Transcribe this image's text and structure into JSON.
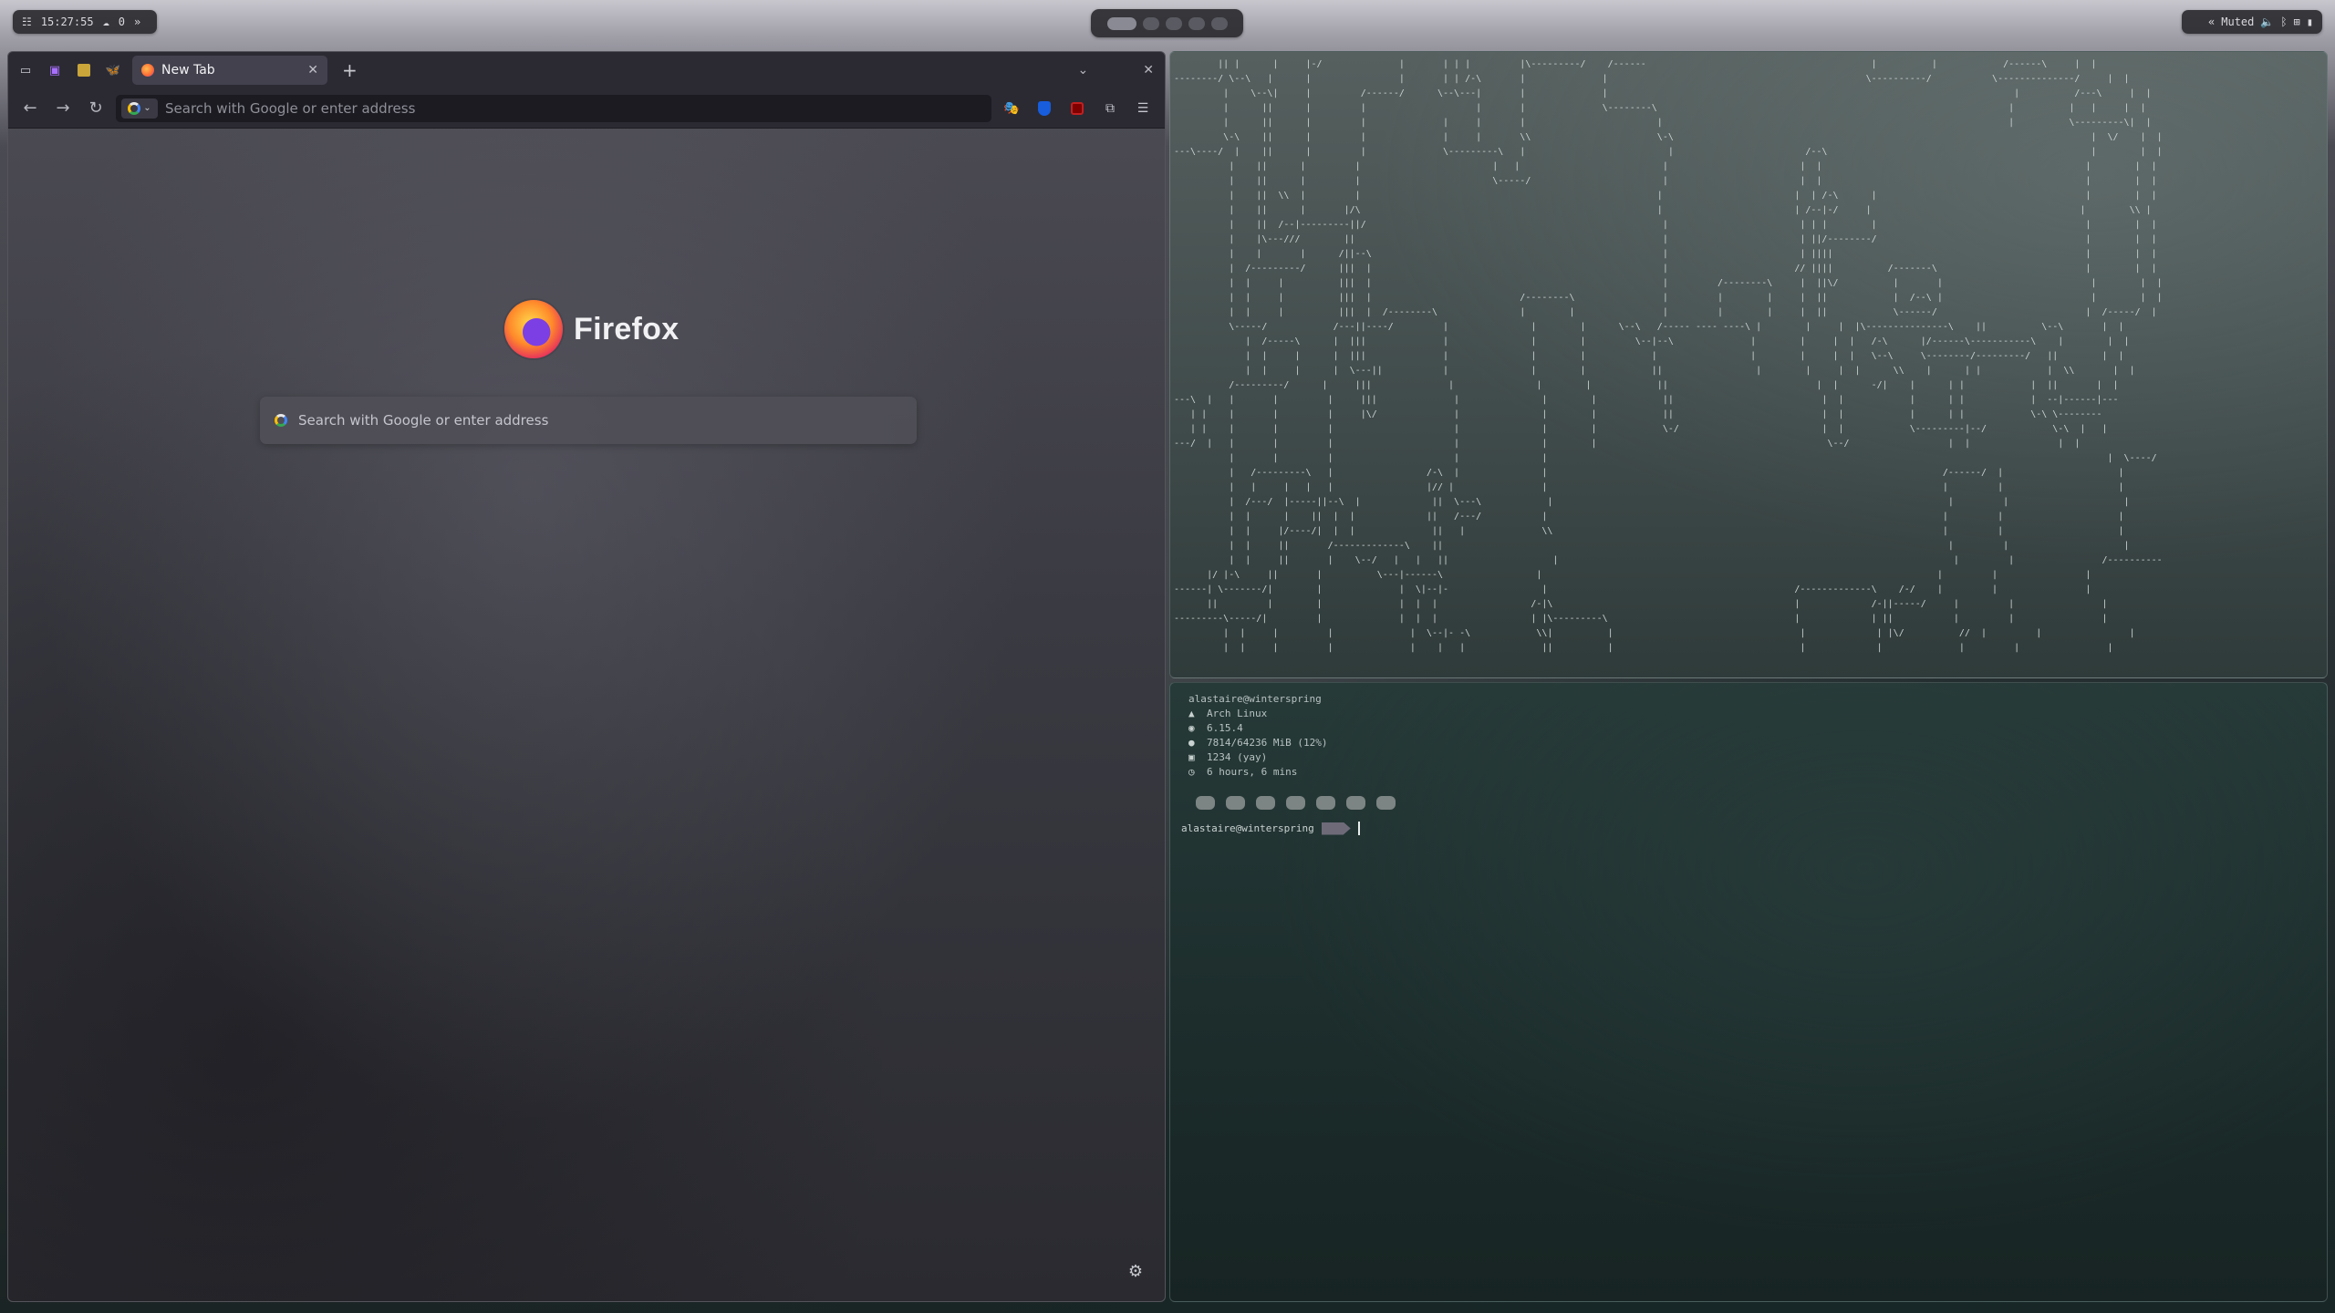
{
  "topbar": {
    "clock": "15:27:55",
    "notifications": "0",
    "workspaces": [
      true,
      false,
      false,
      false,
      false
    ],
    "audio": "Muted",
    "icons": [
      "settings-icon",
      "cloud-icon",
      "chevrons-right-icon",
      "chevrons-left-icon",
      "speaker-icon",
      "bluetooth-icon",
      "network-icon",
      "battery-icon"
    ]
  },
  "firefox": {
    "pinned_tabs": [
      "twitch",
      "yellow-app",
      "bluesky"
    ],
    "active_tab": {
      "title": "New Tab"
    },
    "url_placeholder": "Search with Google or enter address",
    "brand": "Firefox",
    "search_placeholder": "Search with Google or enter address",
    "extensions": [
      "mask-icon",
      "bitwarden-icon",
      "ublock-icon",
      "extensions-icon",
      "menu-icon"
    ]
  },
  "terminal_top": {
    "ascii_art": [
      "        || |      |     |-/              |       | | |         |\\---------/    /------                                         |          |            /------\\     |  |",
      "--------/ \\--\\   |      |                |       | | /-\\       |              |                                               \\----------/           \\--------------/     |  |",
      "         |    \\--\\|     |         /------/      \\--\\---|       |              |                                                                          |          /---\\     |  |",
      "         |      ||      |         |                    |       |              \\--------\\                                                                |          |   |     |  |",
      "         |      ||      |         |              |     |       |                        |                                                               |          \\---------\\|  |",
      "         \\-\\    ||      |         |              |     |       \\\\                       \\-\\                                                                            |  \\/    |  |",
      "---\\----/  |    ||      |         |              \\---------\\   |                          |                        /--\\                                                |        |  |",
      "          |    ||      |         |                        |   |                          |                        |  |                                                |        |  |",
      "          |    ||      |         |                        \\-----/                        |                        |  |                                                |        |  |",
      "          |    ||  \\\\  |         |                                                      |                        |  | /-\\      |                                      |        |  |",
      "          |    ||      |       |/\\                                                      |                        | /--|-/     |                                      |        \\\\ |",
      "          |    ||  /--|---------||/                                                      |                        | | |        |                                      |        |  |",
      "          |    |\\---///        ||                                                        |                        | ||/--------/                                      |        |  |",
      "          |    |       |      /||--\\                                                     |                        | ||||                                              |        |  |",
      "          |  /---------/      |||  |                                                     |                       // ||||          /-------\\                           |        |  |",
      "          |  |     |          |||  |                                                     |         /--------\\     |  ||\\/          |       |                           |        |  |",
      "          |  |     |          |||  |                           /--------\\                |         |        |     |  ||            |  /--\\ |                           |        |  |",
      "          |  |     |          |||  |  /--------\\               |        |                |         |        |     |  ||            \\------/                           |  /-----/  |",
      "          \\-----/            /---||----/         |               |        |      \\--\\   /----- ---- ----\\ |        |     |  |\\---------------\\    ||          \\--\\       |  |",
      "             |  /-----\\      |  |||              |               |        |         \\--|--\\              |        |     |  |   /-\\      |/------\\-----------\\    |        |  |",
      "             |  |     |      |  |||              |               |        |            |                 |        |     |  |   \\--\\     \\--------/---------/   ||        |  |",
      "             |  |     |      |  \\---||           |               |        |            ||                 |        |     |  |      \\\\    |      | |            |  \\\\       |  |",
      "          /---------/      |     |||              |               |        |            ||                           |  |      -/|    |      | |            |  ||       |  |",
      "---\\  |   |       |         |     |||              |               |        |            ||                           |  |            |      | |            |  --|------|---",
      "   | |    |       |         |     |\\/              |               |        |            ||                           |  |            |      | |            \\-\\ \\--------",
      "   | |    |       |         |                      |               |        |            \\-/                          |  |            \\---------|--/            \\-\\  |   |",
      "---/  |   |       |         |                      |               |        |                                          \\--/                  |  |                |  |",
      "          |       |         |                      |               |                                                                                                      |  \\----/",
      "          |   /---------\\   |                 /-\\  |               |                                                                        /------/  |                     |",
      "          |   |     |   |   |                 |// |                |                                                                        |         |                     |",
      "          |  /---/  |-----||--\\  |             ||  \\---\\            |                                                                        |         |                     |",
      "          |  |      |    ||  |  |             ||   /---/           |                                                                        |         |                     |",
      "          |  |     |/----/|  |  |              ||   |              \\\\                                                                       |         |                     |",
      "          |  |     ||       /-------------\\    ||                                                                                            |         |                     |",
      "          |  |     ||       |    \\--/   |   |   ||                   |                                                                        |         |                /----------",
      "      |/ |-\\     ||       |          \\---|------\\                 |                                                                        |         |                |",
      "------| \\-------/|        |              |  \\|--|-                 |                                             /-------------\\    /-/    |         |                |",
      "      ||         |        |              |  |  |                 /-|\\                                            |             /-||-----/     |         |                |",
      "---------\\-----/|         |              |  |  |                 | |\\---------\\                                  |             | ||           |         |                |",
      "         |  |     |         |              |  \\--|- -\\            \\\\|          |                                  |             | |\\/          //  |         |                |",
      "         |  |     |         |              |    |   |              ||          |                                  |             |              |         |                |"
    ]
  },
  "terminal_bottom": {
    "fetch": {
      "user_host": "alastaire@winterspring",
      "os": "Arch Linux",
      "kernel": "6.15.4",
      "memory": "7814/64236 MiB (12%)",
      "packages": "1234 (yay)",
      "uptime": "6 hours, 6 mins"
    },
    "fetch_icons": [
      "arch-icon",
      "kernel-icon",
      "memory-icon",
      "package-icon",
      "clock-icon"
    ],
    "palette": [
      "#7d8584",
      "#7d8584",
      "#7d8584",
      "#7d8584",
      "#7d8584",
      "#7d8584",
      "#7d8584"
    ],
    "prompt": "alastaire@winterspring"
  }
}
